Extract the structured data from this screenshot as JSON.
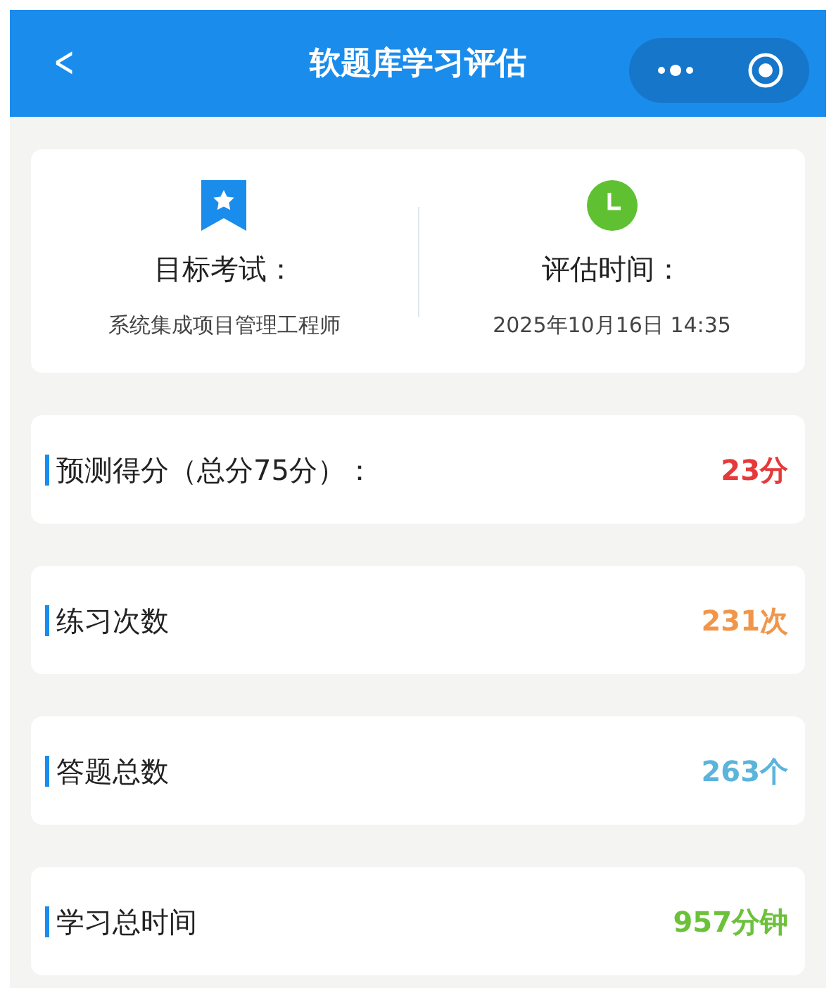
{
  "header": {
    "back": "<",
    "title": "软题库学习评估"
  },
  "info": [
    {
      "kind": "exam",
      "label": "目标考试：",
      "value": "系统集成项目管理工程师"
    },
    {
      "kind": "time",
      "label": "评估时间：",
      "value": "2025年10月16日 14:35"
    }
  ],
  "stats": [
    {
      "label": "预测得分（总分75分）：",
      "value": "23分",
      "color": "#e5393a"
    },
    {
      "label": "练习次数",
      "value": "231次",
      "color": "#f0964b"
    },
    {
      "label": "答题总数",
      "value": "263个",
      "color": "#5ab4dc"
    },
    {
      "label": "学习总时间",
      "value": "957分钟",
      "color": "#6cc13a"
    }
  ]
}
